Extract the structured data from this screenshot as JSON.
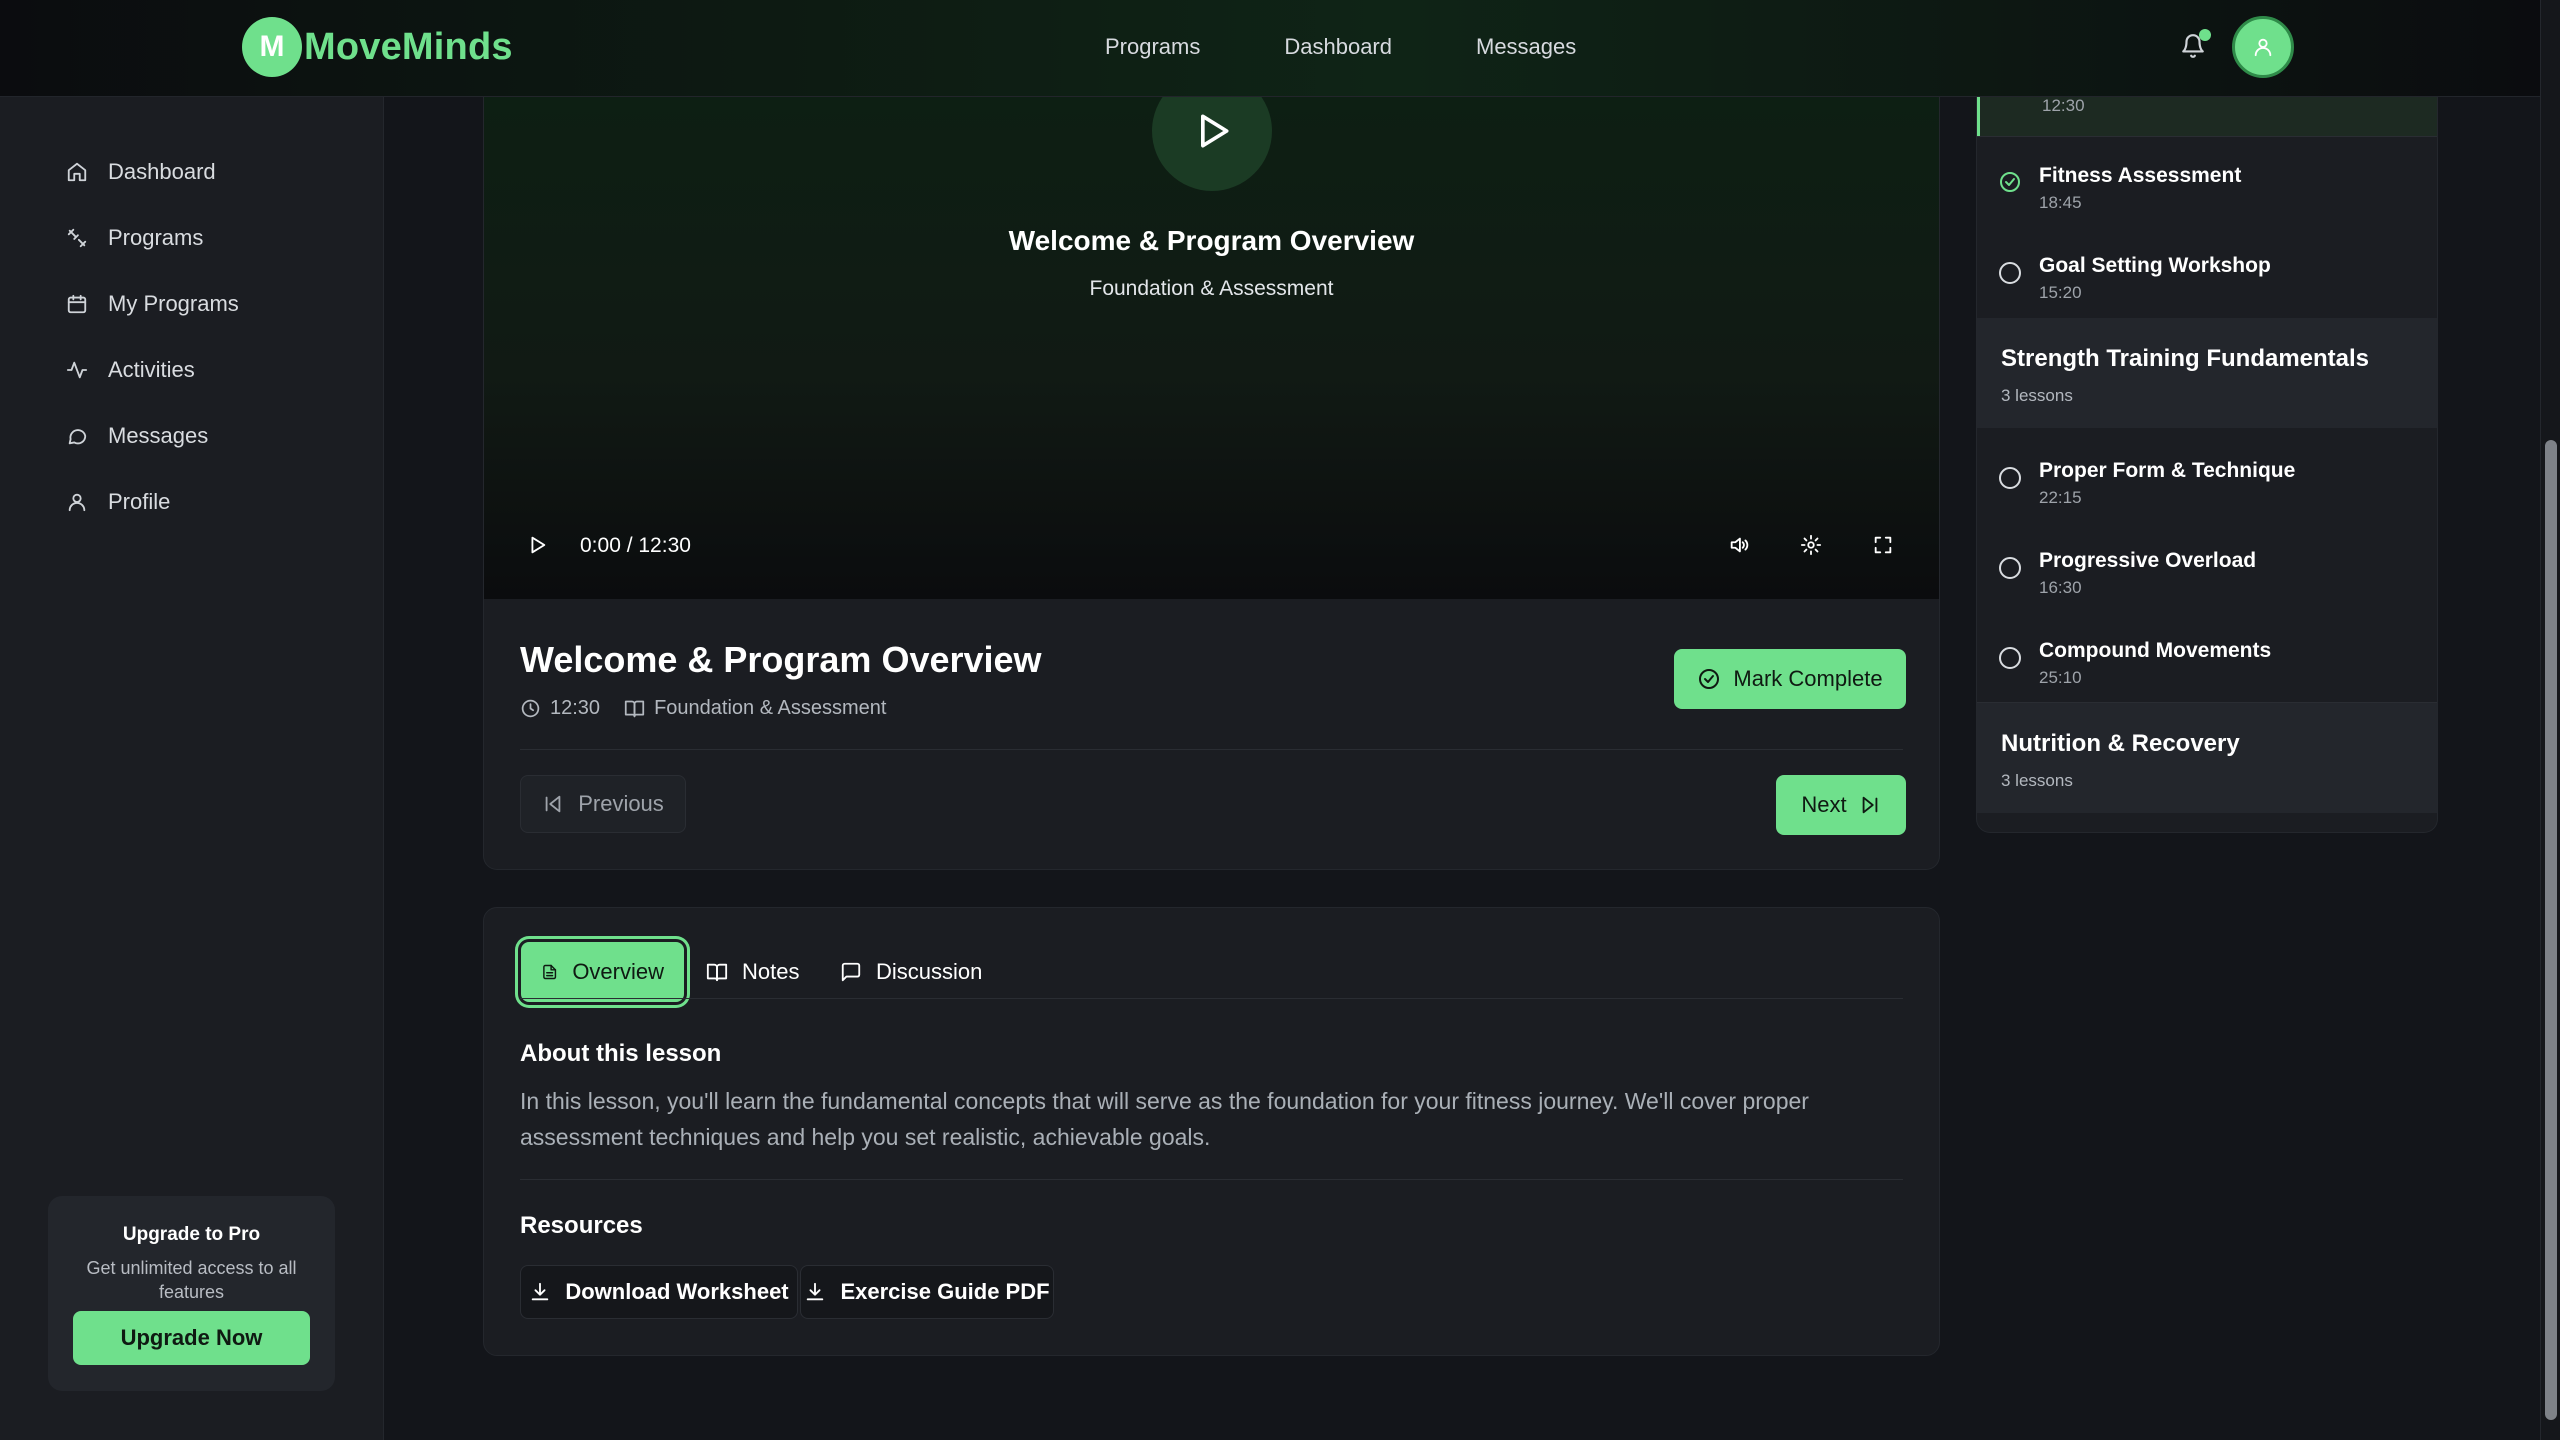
{
  "brand": {
    "initial": "M",
    "name": "MoveMinds"
  },
  "topnav": {
    "links": [
      "Programs",
      "Dashboard",
      "Messages"
    ]
  },
  "sidebar": {
    "items": [
      {
        "label": "Dashboard",
        "icon": "home-icon"
      },
      {
        "label": "Programs",
        "icon": "programs-icon"
      },
      {
        "label": "My Programs",
        "icon": "calendar-icon"
      },
      {
        "label": "Activities",
        "icon": "activity-icon"
      },
      {
        "label": "Messages",
        "icon": "message-icon"
      },
      {
        "label": "Profile",
        "icon": "user-icon"
      }
    ],
    "promo": {
      "title": "Upgrade to Pro",
      "subtitle": "Get unlimited access to all features",
      "button": "Upgrade Now"
    }
  },
  "video": {
    "title": "Welcome & Program Overview",
    "module": "Foundation & Assessment",
    "time": "0:00 / 12:30"
  },
  "lesson": {
    "title": "Welcome & Program Overview",
    "duration": "12:30",
    "module": "Foundation & Assessment",
    "mark_complete": "Mark Complete",
    "previous": "Previous",
    "next": "Next"
  },
  "tabs": {
    "items": [
      "Overview",
      "Notes",
      "Discussion"
    ],
    "active": "Overview"
  },
  "overview": {
    "about_heading": "About this lesson",
    "about_text": "In this lesson, you'll learn the fundamental concepts that will serve as the foundation for your fitness journey. We'll cover proper assessment techniques and help you set realistic, achievable goals.",
    "resources_heading": "Resources",
    "resources": [
      "Download Worksheet",
      "Exercise Guide PDF"
    ]
  },
  "course_outline": {
    "lessons_top": [
      {
        "title": "Fitness Assessment",
        "duration": "18:45",
        "completed": true
      },
      {
        "title": "Goal Setting Workshop",
        "duration": "15:20",
        "completed": false
      }
    ],
    "current_duration": "12:30",
    "modules": [
      {
        "title": "Strength Training Fundamentals",
        "count": "3 lessons",
        "lessons": [
          {
            "title": "Proper Form & Technique",
            "duration": "22:15"
          },
          {
            "title": "Progressive Overload",
            "duration": "16:30"
          },
          {
            "title": "Compound Movements",
            "duration": "25:10"
          }
        ]
      },
      {
        "title": "Nutrition & Recovery",
        "count": "3 lessons"
      }
    ]
  },
  "colors": {
    "accent": "#6fe08c",
    "background": "#13151a",
    "card": "#1b1d22"
  }
}
